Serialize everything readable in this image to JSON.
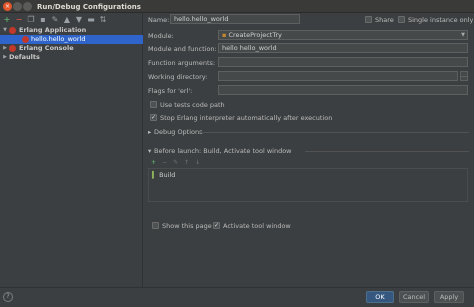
{
  "window": {
    "title": "Run/Debug Configurations",
    "close_glyph": "×"
  },
  "toolbar": {
    "icons": [
      "add-icon",
      "remove-icon",
      "copy-icon",
      "save-icon",
      "settings-icon",
      "move-up-icon",
      "move-down-icon",
      "folder-icon",
      "sort-icon"
    ]
  },
  "tree": {
    "items": [
      {
        "label": "Erlang Application",
        "expanded": true,
        "selected": false,
        "level": 0
      },
      {
        "label": "hello.hello_world",
        "selected": true,
        "level": 1
      },
      {
        "label": "Erlang Console",
        "expanded": false,
        "level": 0
      },
      {
        "label": "Defaults",
        "expanded": false,
        "level": 0
      }
    ]
  },
  "form": {
    "name_label": "Name:",
    "name_value": "hello.hello_world",
    "share_label": "Share",
    "share_checked": false,
    "single_instance_label": "Single instance only",
    "single_instance_checked": false,
    "module_label": "Module:",
    "module_value": "CreateProjectTry",
    "module_function_label": "Module and function:",
    "module_function_value": "hello hello_world",
    "function_args_label": "Function arguments:",
    "function_args_value": "",
    "working_dir_label": "Working directory:",
    "working_dir_value": "",
    "flags_label": "Flags for 'erl':",
    "flags_value": "",
    "use_tests_label": "Use tests code path",
    "use_tests_checked": false,
    "stop_erlang_label": "Stop Erlang interpreter automatically after execution",
    "stop_erlang_checked": true,
    "debug_options_label": "Debug Options",
    "before_launch_label": "Before launch: Build, Activate tool window",
    "before_launch_items": [
      "Build"
    ],
    "show_page_label": "Show this page",
    "show_page_checked": false,
    "activate_tool_label": "Activate tool window",
    "activate_tool_checked": true
  },
  "buttons": {
    "help": "?",
    "ok": "OK",
    "cancel": "Cancel",
    "apply": "Apply"
  },
  "colors": {
    "accent": "#2f65ca",
    "background": "#3c3f41",
    "ok_button": "#365880",
    "close_button": "#e2572c"
  }
}
